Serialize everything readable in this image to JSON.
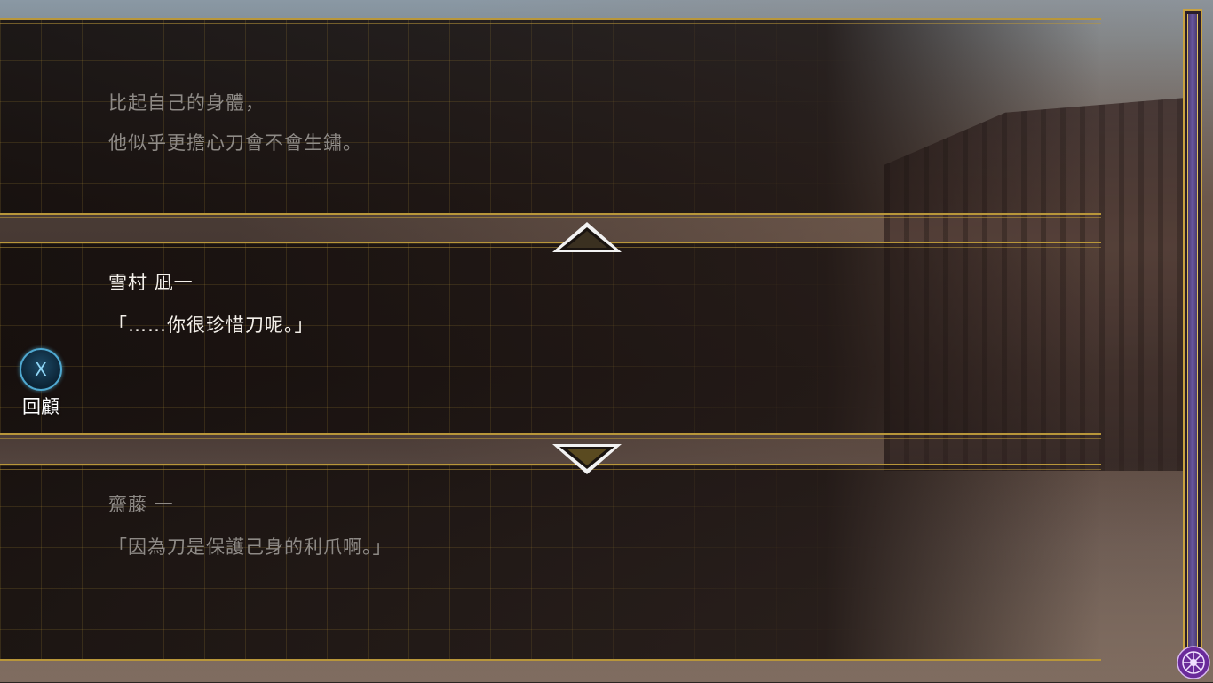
{
  "backlog": [
    {
      "speaker": "",
      "lines": [
        "比起自己的身體，",
        "他似乎更擔心刀會不會生鏽。"
      ]
    },
    {
      "speaker": "雪村 凪一",
      "lines": [
        "「……你很珍惜刀呢。」"
      ]
    },
    {
      "speaker": "齋藤 一",
      "lines": [
        "「因為刀是保護己身的利爪啊。」"
      ]
    }
  ],
  "review_button": {
    "key": "X",
    "label": "回顧"
  },
  "icons": {
    "scroll_up": "triangle-up-icon",
    "scroll_down": "triangle-down-icon",
    "menu": "crest-icon"
  },
  "colors": {
    "gold_trim": "#b8963a",
    "dim_text": "#8e8a86",
    "active_text": "#f4f0ea",
    "button_blue": "#4fa8d0",
    "scroll_purple": "#6a58a0"
  }
}
